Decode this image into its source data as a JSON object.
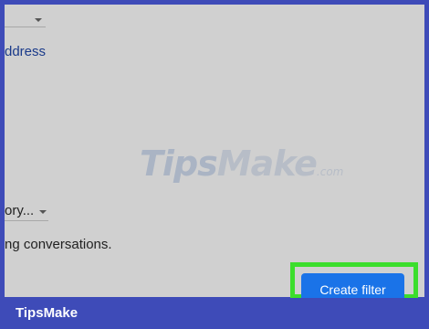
{
  "filter_form": {
    "address_link": "ddress",
    "category_select": "ory...",
    "conversations_text": "ng conversations."
  },
  "watermark": {
    "tips": "Tips",
    "make": "Make",
    "com": ".com"
  },
  "actions": {
    "create_filter_label": "Create filter"
  },
  "footer": {
    "brand": "TipsMake"
  },
  "colors": {
    "background": "#3e4bb8",
    "panel": "#d0d0d0",
    "button": "#1a73e8",
    "highlight": "#3bde2c"
  },
  "icons": [
    "chevron-down-icon"
  ]
}
